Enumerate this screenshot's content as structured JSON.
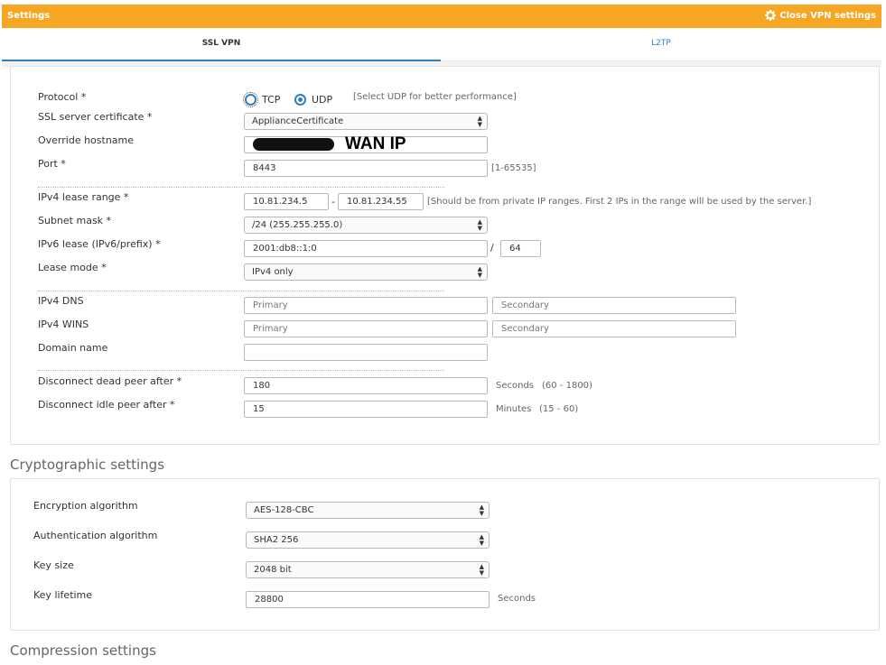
{
  "header": {
    "title": "Settings",
    "close_label": "Close VPN settings"
  },
  "tabs": [
    {
      "label": "SSL VPN"
    },
    {
      "label": "L2TP"
    }
  ],
  "ssl": {
    "protocol_label": "Protocol *",
    "tcp_label": "TCP",
    "udp_label": "UDP",
    "protocol_hint": "[Select UDP for better performance]",
    "cert_label": "SSL server certificate *",
    "cert_value": "ApplianceCertificate",
    "hostname_label": "Override hostname",
    "hostname_annotation": "WAN IP",
    "port_label": "Port *",
    "port_value": "8443",
    "port_hint": "[1-65535]",
    "ipv4_lease_label": "IPv4 lease range *",
    "ipv4_lease_start": "10.81.234.5",
    "range_dash": "-",
    "ipv4_lease_end": "10.81.234.55",
    "ipv4_lease_hint": "[Should be from private IP ranges. First 2 IPs in the range will be used by the server.]",
    "subnet_label": "Subnet mask *",
    "subnet_value": "/24 (255.255.255.0)",
    "ipv6_lease_label": "IPv6 lease (IPv6/prefix) *",
    "ipv6_lease_value": "2001:db8::1:0",
    "slash": "/",
    "ipv6_prefix": "64",
    "lease_mode_label": "Lease mode *",
    "lease_mode_value": "IPv4 only",
    "dns_label": "IPv4 DNS",
    "wins_label": "IPv4 WINS",
    "primary_placeholder": "Primary",
    "secondary_placeholder": "Secondary",
    "domain_label": "Domain name",
    "dead_peer_label": "Disconnect dead peer after *",
    "dead_peer_value": "180",
    "dead_peer_unit": "Seconds",
    "dead_peer_range": "(60 - 1800)",
    "idle_peer_label": "Disconnect idle peer after *",
    "idle_peer_value": "15",
    "idle_peer_unit": "Minutes",
    "idle_peer_range": "(15 - 60)"
  },
  "crypto": {
    "title": "Cryptographic settings",
    "enc_label": "Encryption algorithm",
    "enc_value": "AES-128-CBC",
    "auth_label": "Authentication algorithm",
    "auth_value": "SHA2 256",
    "keysize_label": "Key size",
    "keysize_value": "2048 bit",
    "lifetime_label": "Key lifetime",
    "lifetime_value": "28800",
    "lifetime_unit": "Seconds"
  },
  "compression": {
    "title": "Compression settings"
  },
  "icons": {
    "close": "gear-icon",
    "select": "chevron-updown-icon"
  },
  "colors": {
    "header": "#f6a623",
    "accent": "#2d7fc1"
  }
}
